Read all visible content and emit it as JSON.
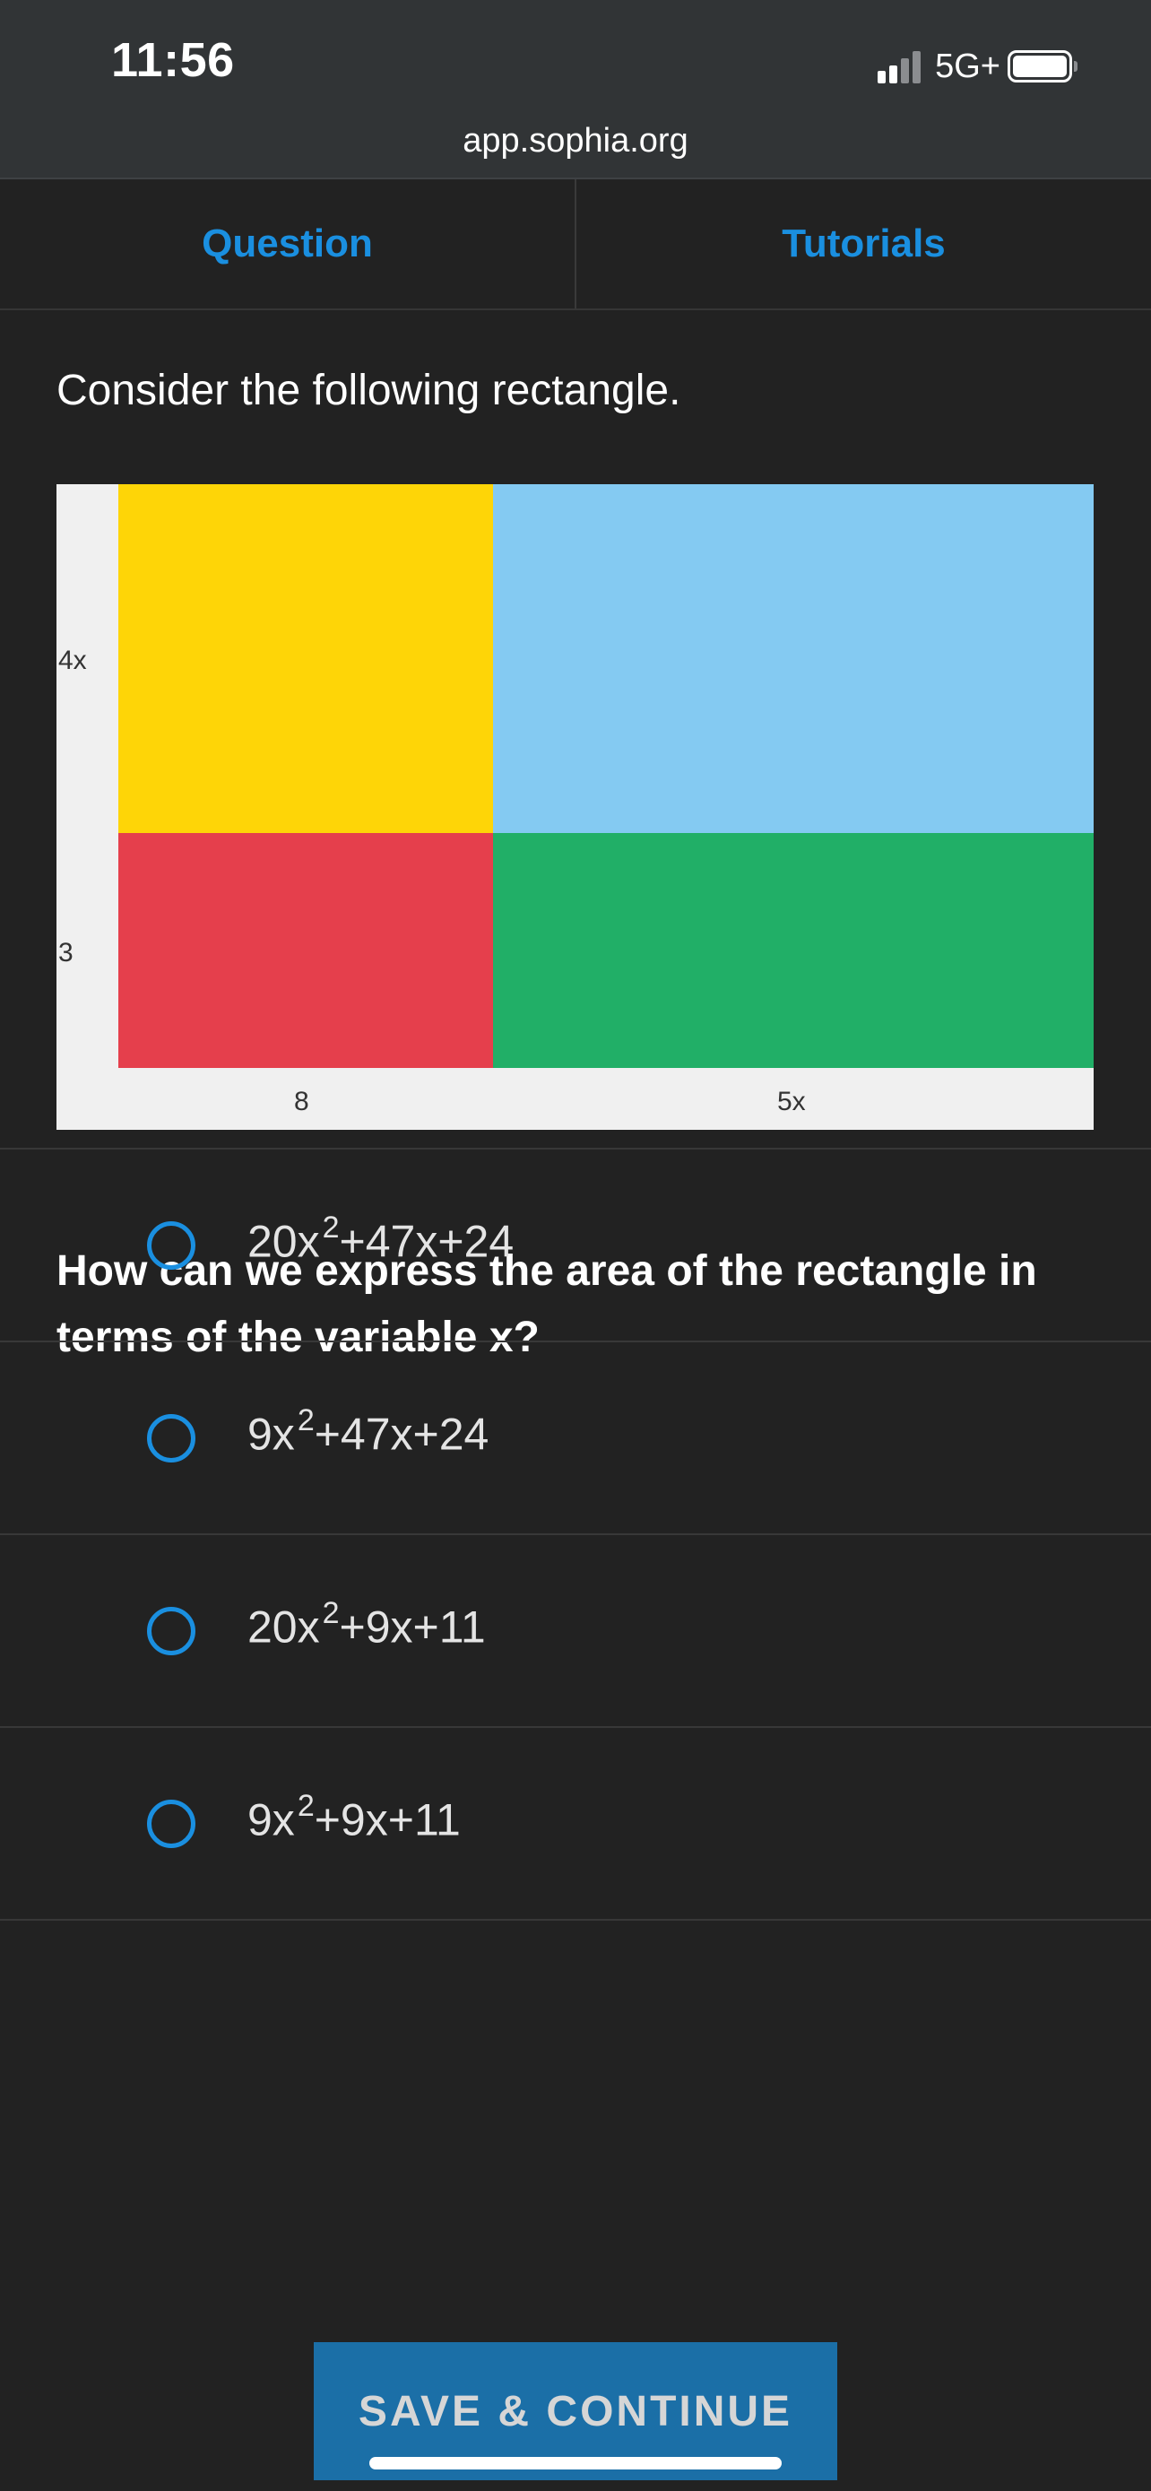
{
  "status_bar": {
    "time": "11:56",
    "network": "5G+",
    "signal_bars_filled": 2,
    "signal_bars_total": 4,
    "battery_level": 1.0
  },
  "browser": {
    "url": "app.sophia.org"
  },
  "tabs": [
    {
      "label": "Question"
    },
    {
      "label": "Tutorials"
    }
  ],
  "intro_text": "Consider the following rectangle.",
  "figure": {
    "labels": {
      "side_top": "4x",
      "side_bottom": "3",
      "bottom_left": "8",
      "bottom_right": "5x"
    },
    "colors": {
      "top_left": "#FED507",
      "top_right": "#84CAF2",
      "bottom_left": "#E53F4C",
      "bottom_right": "#21AF67",
      "background": "#F0F0F0"
    }
  },
  "question_text": "How can we express the area of the rectangle in terms of the variable x?",
  "options": [
    {
      "coef": "20x",
      "exp": "2",
      "rest": "+47x+24"
    },
    {
      "coef": "9x",
      "exp": "2",
      "rest": "+47x+24"
    },
    {
      "coef": "20x",
      "exp": "2",
      "rest": "+9x+11"
    },
    {
      "coef": "9x",
      "exp": "2",
      "rest": "+9x+11"
    }
  ],
  "save_button": {
    "label": "SAVE & CONTINUE"
  },
  "colors": {
    "accent": "#1A8FE0",
    "background": "#222222",
    "status_bar": "#313436",
    "button": "#1B6FA7"
  }
}
